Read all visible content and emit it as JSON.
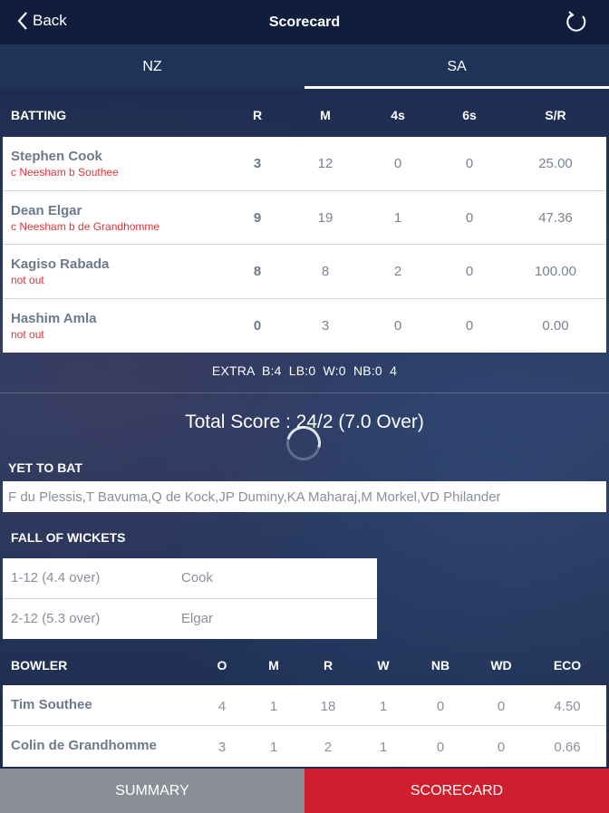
{
  "header": {
    "back_label": "Back",
    "title": "Scorecard"
  },
  "tabs": [
    {
      "label": "NZ"
    },
    {
      "label": "SA"
    }
  ],
  "batting": {
    "heading": "BATTING",
    "columns": [
      "R",
      "M",
      "4s",
      "6s",
      "S/R"
    ],
    "rows": [
      {
        "name": "Stephen Cook",
        "status": "c Neesham b Southee",
        "r": "3",
        "m": "12",
        "fours": "0",
        "sixes": "0",
        "sr": "25.00"
      },
      {
        "name": "Dean Elgar",
        "status": "c Neesham b de Grandhomme",
        "r": "9",
        "m": "19",
        "fours": "1",
        "sixes": "0",
        "sr": "47.36"
      },
      {
        "name": "Kagiso Rabada",
        "status": "not out",
        "r": "8",
        "m": "8",
        "fours": "2",
        "sixes": "0",
        "sr": "100.00"
      },
      {
        "name": "Hashim Amla",
        "status": "not out",
        "r": "0",
        "m": "3",
        "fours": "0",
        "sixes": "0",
        "sr": "0.00"
      }
    ]
  },
  "extras": "EXTRA  B:4  LB:0  W:0  NB:0  4",
  "total_score": "Total Score : 24/2 (7.0 Over)",
  "yet_to_bat": {
    "heading": "YET TO BAT",
    "players": "F du Plessis,T Bavuma,Q de Kock,JP Duminy,KA Maharaj,M Morkel,VD Philander"
  },
  "fall_of_wickets": {
    "heading": "FALL OF WICKETS",
    "rows": [
      {
        "score": "1-12 (4.4 over)",
        "player": "Cook"
      },
      {
        "score": "2-12 (5.3 over)",
        "player": "Elgar"
      }
    ]
  },
  "bowling": {
    "heading": "BOWLER",
    "columns": [
      "O",
      "M",
      "R",
      "W",
      "NB",
      "WD",
      "ECO"
    ],
    "rows": [
      {
        "name": "Tim Southee",
        "o": "4",
        "m": "1",
        "r": "18",
        "w": "1",
        "nb": "0",
        "wd": "0",
        "eco": "4.50"
      },
      {
        "name": "Colin de Grandhomme",
        "o": "3",
        "m": "1",
        "r": "2",
        "w": "1",
        "nb": "0",
        "wd": "0",
        "eco": "0.66"
      }
    ]
  },
  "bottom_tabs": [
    {
      "label": "SUMMARY"
    },
    {
      "label": "SCORECARD"
    }
  ],
  "colors": {
    "header": "#101d3c",
    "tab_bar": "#1f3358",
    "accent_red": "#cf1e2e",
    "status_red": "#e3323c",
    "summary_gray": "#8a8f97"
  }
}
